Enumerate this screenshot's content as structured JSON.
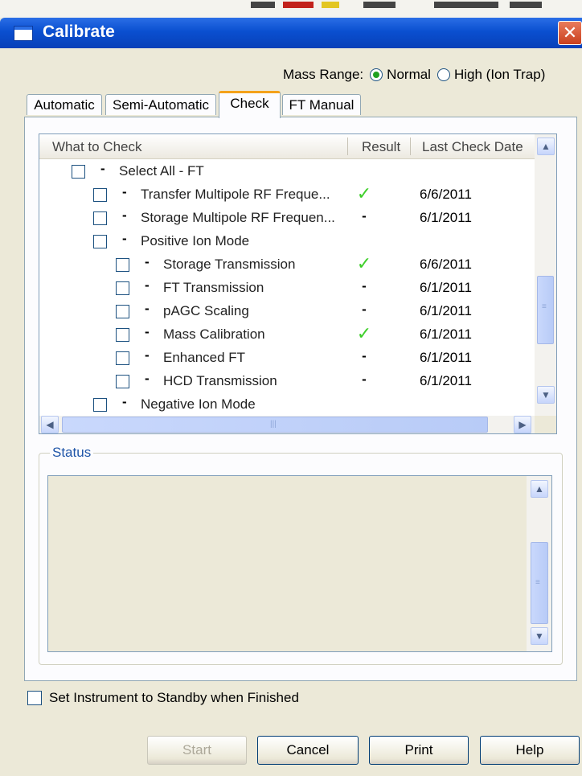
{
  "window": {
    "title": "Calibrate",
    "close_glyph": "✕"
  },
  "mass_range": {
    "label": "Mass Range:",
    "options": [
      {
        "label": "Normal",
        "selected": true
      },
      {
        "label": "High (Ion Trap)",
        "selected": false
      }
    ]
  },
  "tabs": [
    {
      "label": "Automatic",
      "active": false
    },
    {
      "label": "Semi-Automatic",
      "active": false
    },
    {
      "label": "Check",
      "active": true
    },
    {
      "label": "FT Manual",
      "active": false
    }
  ],
  "check_tree": {
    "columns": [
      "What to Check",
      "Result",
      "Last Check Date"
    ],
    "rows": [
      {
        "label": "Select All - FT",
        "level": 0,
        "result": "",
        "date": ""
      },
      {
        "label": "Transfer Multipole RF Freque...",
        "level": 1,
        "result": "✓",
        "date": "6/6/2011"
      },
      {
        "label": "Storage Multipole RF Frequen...",
        "level": 1,
        "result": "-",
        "date": "6/1/2011"
      },
      {
        "label": "Positive Ion Mode",
        "level": 1,
        "result": "",
        "date": ""
      },
      {
        "label": "Storage Transmission",
        "level": 2,
        "result": "✓",
        "date": "6/6/2011"
      },
      {
        "label": "FT Transmission",
        "level": 2,
        "result": "-",
        "date": "6/1/2011"
      },
      {
        "label": "pAGC Scaling",
        "level": 2,
        "result": "-",
        "date": "6/1/2011"
      },
      {
        "label": "Mass Calibration",
        "level": 2,
        "result": "✓",
        "date": "6/1/2011"
      },
      {
        "label": "Enhanced FT",
        "level": 2,
        "result": "-",
        "date": "6/1/2011"
      },
      {
        "label": "HCD Transmission",
        "level": 2,
        "result": "-",
        "date": "6/1/2011"
      },
      {
        "label": "Negative Ion Mode",
        "level": 1,
        "result": "",
        "date": ""
      }
    ]
  },
  "status": {
    "label": "Status",
    "text": ""
  },
  "standby": {
    "label": "Set Instrument to Standby when Finished",
    "checked": false
  },
  "buttons": {
    "start": "Start",
    "cancel": "Cancel",
    "print": "Print",
    "help": "Help"
  },
  "icons": {
    "scroll_up": "▲",
    "scroll_down": "▼",
    "scroll_left": "◀",
    "scroll_right": "▶",
    "grip_v": "≡",
    "grip_h": "|||"
  },
  "colors": {
    "title_bar": "#0a4fd0",
    "active_tab_accent": "#f4a21a",
    "ok_check": "#3ecf2a",
    "radio_dot": "#21a121"
  }
}
